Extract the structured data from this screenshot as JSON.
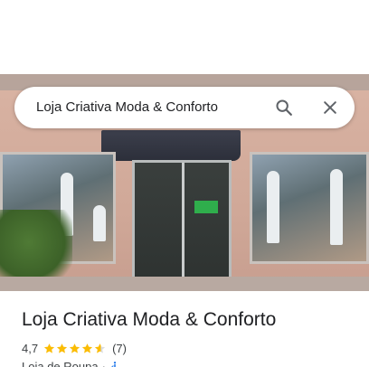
{
  "search": {
    "query": "Loja Criativa Moda & Conforto"
  },
  "place": {
    "name": "Loja Criativa Moda & Conforto",
    "rating": "4,7",
    "stars": 4.7,
    "review_count": "(7)",
    "category": "Loja de Roupa",
    "separator": "·",
    "accessibility_icon": "wheelchair-icon"
  },
  "colors": {
    "star": "#fbbc04",
    "accessibility": "#1a73e8",
    "text_primary": "#202124",
    "text_secondary": "#3c4043"
  },
  "icons": {
    "search": "search-icon",
    "close": "close-icon"
  }
}
